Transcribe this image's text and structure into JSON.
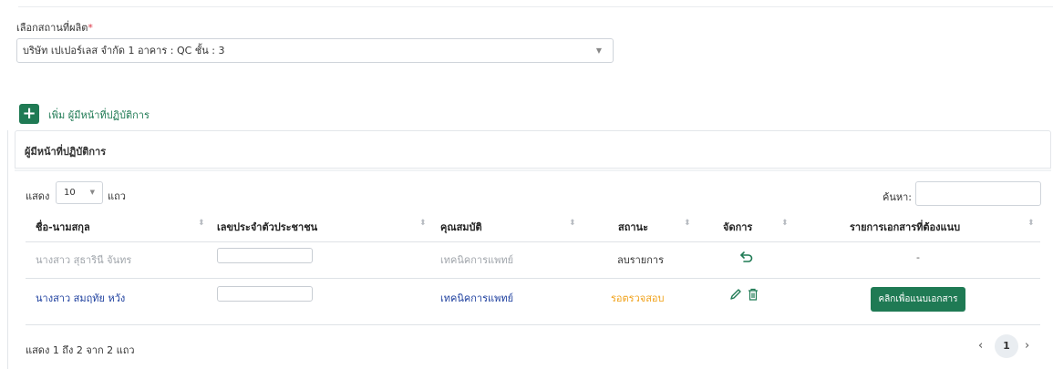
{
  "site": {
    "label": "เลือกสถานที่ผลิต",
    "required_mark": "*",
    "selected": "บริษัท เปเปอร์เลส จำกัด 1 อาคาร : QC ชั้น : 3"
  },
  "add": {
    "icon": "+",
    "label": "เพิ่ม ผู้มีหน้าที่ปฏิบัติการ"
  },
  "card": {
    "title": "ผู้มีหน้าที่ปฏิบัติการ"
  },
  "table_controls": {
    "show_label": "แสดง",
    "page_length": "10",
    "rows_label": "แถว",
    "search_label": "ค้นหา:"
  },
  "columns": [
    "ชื่อ-นามสกุล",
    "เลขประจำตัวประชาชน",
    "คุณสมบัติ",
    "สถานะ",
    "จัดการ",
    "รายการเอกสารที่ต้องแนบ"
  ],
  "rows": [
    {
      "name": "นางสาว สุธารินี จันทร",
      "qualification": "เทคนิคการแพทย์",
      "status": "ลบรายการ",
      "documents": "-",
      "action": "undo-icon"
    },
    {
      "name": "นางสาว สมฤทัย หวัง",
      "qualification": "เทคนิคการแพทย์",
      "status": "รอตรวจสอบ",
      "documents_button": "คลิกเพื่อแนบเอกสาร",
      "action": "edit-icon, trash-icon"
    }
  ],
  "footer": {
    "info": "แสดง 1 ถึง 2 จาก 2 แถว",
    "current_page": "1",
    "prev": "‹",
    "next": "›"
  },
  "colors": {
    "primary": "#1f7a54",
    "link": "#1d3f9e",
    "pending": "#f0a21b",
    "required": "#dc3545"
  }
}
